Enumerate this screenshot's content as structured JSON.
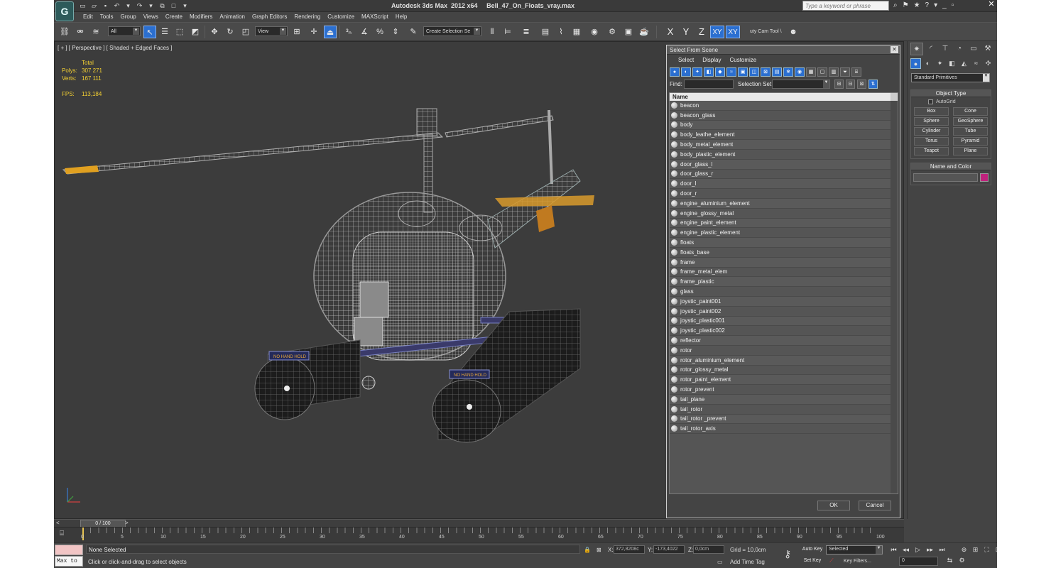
{
  "app": {
    "title": "Autodesk 3ds Max  2012 x64     Bell_47_On_Floats_vray.max",
    "search_placeholder": "Type a keyword or phrase",
    "logo_glyph": "G"
  },
  "menu": [
    "Edit",
    "Tools",
    "Group",
    "Views",
    "Create",
    "Modifiers",
    "Animation",
    "Graph Editors",
    "Rendering",
    "Customize",
    "MAXScript",
    "Help"
  ],
  "toolbar": {
    "filter_value": "All",
    "ref_coord_value": "View",
    "named_selection_placeholder": "Create Selection Se",
    "axes": [
      "X",
      "Y",
      "Z",
      "XY",
      "XY"
    ],
    "camera_tool_label": "uty Cam Tool \\"
  },
  "viewport": {
    "label": "[ + ] [ Perspective ] [ Shaded + Edged Faces ]",
    "stats": {
      "header": "Total",
      "polys_label": "Polys:",
      "polys_value": "307 271",
      "verts_label": "Verts:",
      "verts_value": "167 111",
      "fps_label": "FPS:",
      "fps_value": "113,184"
    },
    "decal_text": "NO HAND HOLD"
  },
  "dialog": {
    "title": "Select From Scene",
    "menu": [
      "Select",
      "Display",
      "Customize"
    ],
    "find_label": "Find:",
    "selection_set_label": "Selection Set:",
    "column_header": "Name",
    "objects": [
      "beacon",
      "beacon_glass",
      "body",
      "body_leathe_element",
      "body_metal_element",
      "body_plastic_element",
      "door_glass_l",
      "door_glass_r",
      "door_l",
      "door_r",
      "engine_aluminium_element",
      "engine_glossy_metal",
      "engine_paint_element",
      "engine_plastic_element",
      "floats",
      "floats_base",
      "frame",
      "frame_metal_elem",
      "frame_plastic",
      "glass",
      "joystic_paint001",
      "joystic_paint002",
      "joystic_plastic001",
      "joystic_plastic002",
      "reflector",
      "rotor",
      "rotor_aluminium_element",
      "rotor_glossy_metal",
      "rotor_paint_element",
      "rotor_prevent",
      "tail_plane",
      "tail_rotor",
      "tail_rotor _prevent",
      "tail_rotor_axis"
    ],
    "ok_label": "OK",
    "cancel_label": "Cancel"
  },
  "command_panel": {
    "category_value": "Standard Primitives",
    "object_type_title": "Object Type",
    "autogrid_label": "AutoGrid",
    "primitives": [
      "Box",
      "Cone",
      "Sphere",
      "GeoSphere",
      "Cylinder",
      "Tube",
      "Torus",
      "Pyramid",
      "Teapot",
      "Plane"
    ],
    "name_color_title": "Name and Color",
    "object_color": "#c0237d"
  },
  "timeline": {
    "slider_label": "0 / 100",
    "ticks": [
      "0",
      "5",
      "10",
      "15",
      "20",
      "25",
      "30",
      "35",
      "40",
      "45",
      "50",
      "55",
      "60",
      "65",
      "70",
      "75",
      "80",
      "85",
      "90",
      "95",
      "100"
    ]
  },
  "status": {
    "maxscript_label": "Max to",
    "selection_status": "None Selected",
    "prompt": "Click or click-and-drag to select objects",
    "x_label": "X:",
    "x_value": "372,8208c",
    "y_label": "Y:",
    "y_value": "-173,4022",
    "z_label": "Z:",
    "z_value": "0,0cm",
    "grid": "Grid = 10,0cm",
    "add_time_tag": "Add Time Tag",
    "auto_key": "Auto Key",
    "set_key": "Set Key",
    "selected_value": "Selected",
    "key_filters": "Key Filters...",
    "frame_value": "0"
  }
}
